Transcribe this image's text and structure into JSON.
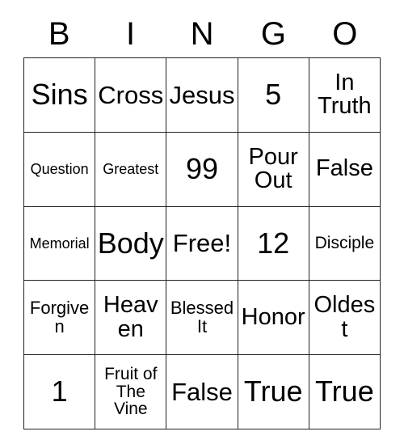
{
  "card": {
    "type": "bingo-card",
    "columns": 5,
    "rows": 5,
    "background_color": "#ffffff",
    "text_color": "#000000",
    "border_color": "#222222"
  },
  "header": {
    "letters": [
      "B",
      "I",
      "N",
      "G",
      "O"
    ]
  },
  "grid": {
    "rows": [
      [
        {
          "text": "Sins",
          "size": "fs-xl"
        },
        {
          "text": "Cross",
          "size": "fs-lg"
        },
        {
          "text": "Jesus",
          "size": "fs-lg"
        },
        {
          "text": "5",
          "size": "fs-xl"
        },
        {
          "text": "In Truth",
          "size": "fs-md"
        }
      ],
      [
        {
          "text": "Question",
          "size": "fs-xxs"
        },
        {
          "text": "Greatest",
          "size": "fs-xxs"
        },
        {
          "text": "99",
          "size": "fs-xl"
        },
        {
          "text": "Pour Out",
          "size": "fs-md"
        },
        {
          "text": "False",
          "size": "fs-md"
        }
      ],
      [
        {
          "text": "Memorial",
          "size": "fs-xxs"
        },
        {
          "text": "Body",
          "size": "fs-xl"
        },
        {
          "text": "Free!",
          "size": "fs-lg"
        },
        {
          "text": "12",
          "size": "fs-xl"
        },
        {
          "text": "Disciple",
          "size": "fs-xs"
        }
      ],
      [
        {
          "text": "Forgiven",
          "size": "fs-sm"
        },
        {
          "text": "Heaven",
          "size": "fs-md"
        },
        {
          "text": "Blessed It",
          "size": "fs-sm"
        },
        {
          "text": "Honor",
          "size": "fs-md"
        },
        {
          "text": "Oldest",
          "size": "fs-md"
        }
      ],
      [
        {
          "text": "1",
          "size": "fs-xl"
        },
        {
          "text": "Fruit of The Vine",
          "size": "fs-xs"
        },
        {
          "text": "False",
          "size": "fs-lg"
        },
        {
          "text": "True",
          "size": "fs-xl"
        },
        {
          "text": "True",
          "size": "fs-xl"
        }
      ]
    ]
  }
}
